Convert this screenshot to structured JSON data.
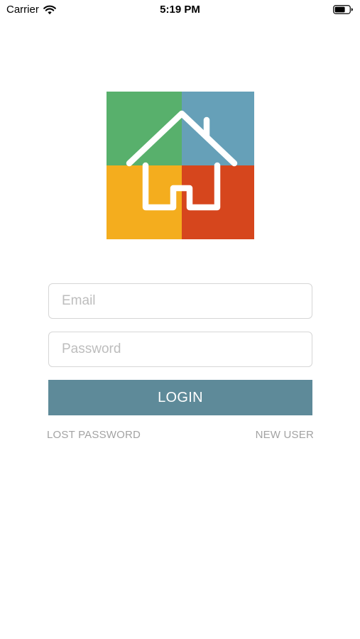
{
  "status_bar": {
    "carrier": "Carrier",
    "time": "5:19 PM",
    "wifi_icon": "wifi-icon",
    "battery_icon": "battery-icon"
  },
  "logo": {
    "icon": "house-icon",
    "colors": {
      "top_left": "#58b06c",
      "top_right": "#66a0b8",
      "bottom_left": "#f4ad1e",
      "bottom_right": "#d6461d",
      "house_outline": "#ffffff"
    }
  },
  "form": {
    "email": {
      "placeholder": "Email",
      "value": ""
    },
    "password": {
      "placeholder": "Password",
      "value": ""
    },
    "login_label": "LOGIN",
    "login_color": "#5e8a99"
  },
  "links": {
    "lost_password": "LOST PASSWORD",
    "new_user": "NEW USER"
  }
}
